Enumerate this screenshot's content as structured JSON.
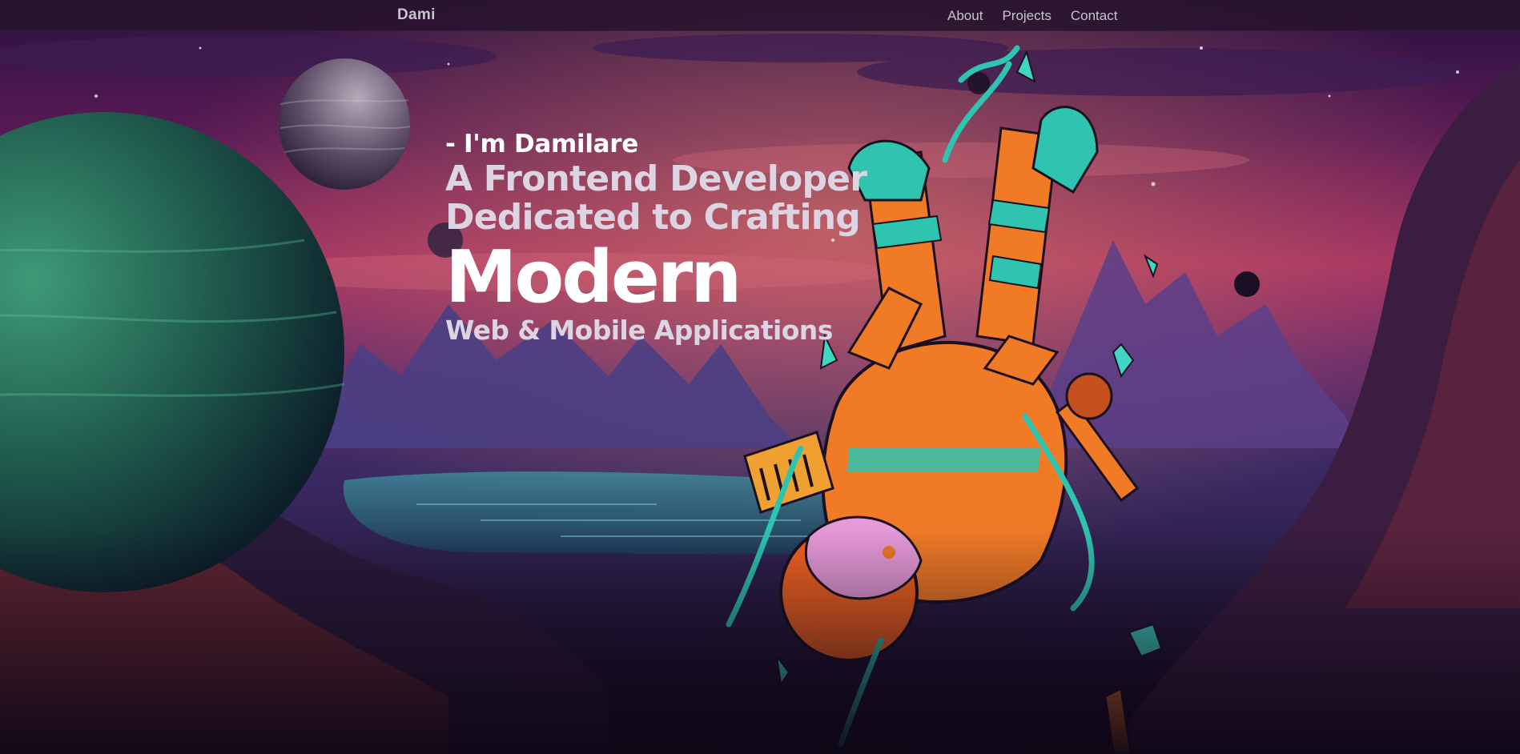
{
  "nav": {
    "brand": "Dami",
    "links": [
      "About",
      "Projects",
      "Contact"
    ]
  },
  "hero": {
    "intro": "- I'm Damilare",
    "role_line1": "A Frontend Developer",
    "role_line2": "Dedicated to Crafting",
    "highlight": "Modern",
    "subline": "Web & Mobile Applications"
  },
  "colors": {
    "nav_bg": "#26122c",
    "nav_text": "#c9c3cf",
    "heading_white": "#ffffff",
    "heading_soft": "#dcd4e2",
    "sky_top": "#2a1240",
    "sky_glow": "#c63a6a",
    "planet_green": "#2f7a62",
    "astronaut_orange": "#f07a26",
    "astronaut_teal": "#2ec4b0"
  },
  "illustration": {
    "scene": "space-landscape",
    "elements": [
      "green-planet",
      "grey-planet",
      "astronaut",
      "mountains",
      "lake",
      "stars"
    ]
  }
}
